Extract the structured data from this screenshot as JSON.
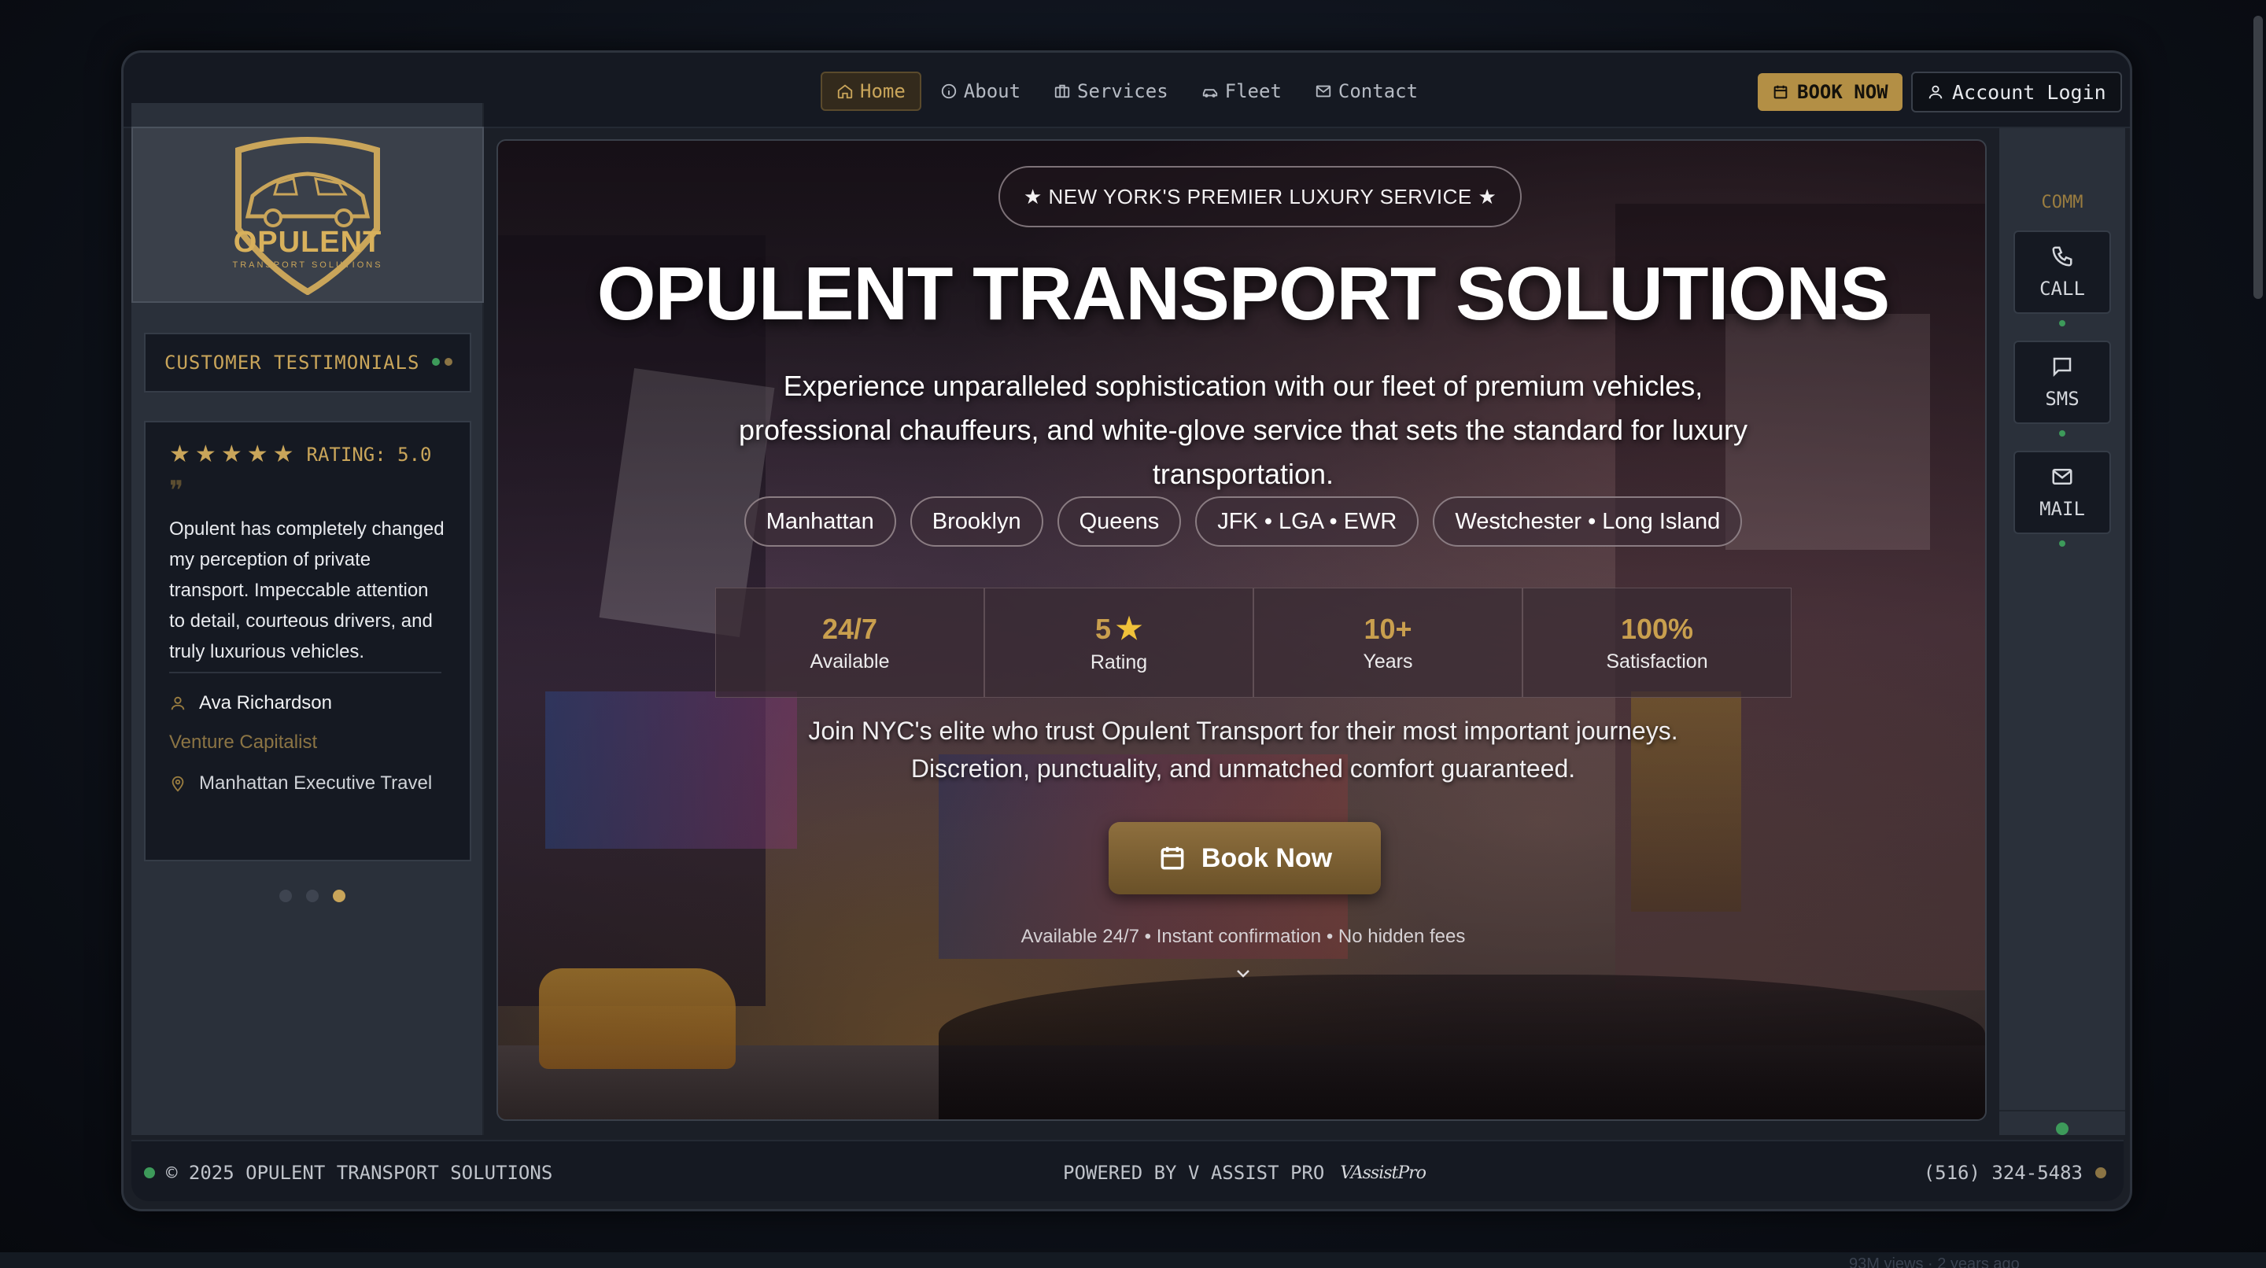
{
  "nav": {
    "links": [
      {
        "label": "Home",
        "icon": "home-icon",
        "active": true
      },
      {
        "label": "About",
        "icon": "info-icon",
        "active": false
      },
      {
        "label": "Services",
        "icon": "briefcase-icon",
        "active": false
      },
      {
        "label": "Fleet",
        "icon": "car-icon",
        "active": false
      },
      {
        "label": "Contact",
        "icon": "mail-icon",
        "active": false
      }
    ],
    "book_label": "BOOK NOW",
    "login_label": "Account Login"
  },
  "brand": {
    "logo_name": "OPULENT",
    "logo_tagline": "TRANSPORT SOLUTIONS",
    "gold": "#c9a55a"
  },
  "testimonials": {
    "header": "CUSTOMER TESTIMONIALS",
    "rating_label": "RATING: 5.0",
    "stars": 5,
    "quote": "Opulent has completely changed my perception of private transport. Impeccable attention to detail, courteous drivers, and truly luxurious vehicles.",
    "author": "Ava Richardson",
    "role": "Venture Capitalist",
    "location": "Manhattan Executive Travel",
    "page_count": 3,
    "active_page": 3
  },
  "hero": {
    "badge": "★ NEW YORK'S PREMIER LUXURY SERVICE ★",
    "title": "OPULENT TRANSPORT SOLUTIONS",
    "description": "Experience unparalleled sophistication with our fleet of premium vehicles, professional chauffeurs, and white-glove service that sets the standard for luxury transportation.",
    "tags": [
      "Manhattan",
      "Brooklyn",
      "Queens",
      "JFK • LGA • EWR",
      "Westchester • Long Island"
    ],
    "stats": [
      {
        "value": "24/7",
        "label": "Available"
      },
      {
        "value": "5",
        "label": "Rating",
        "star": true
      },
      {
        "value": "10+",
        "label": "Years"
      },
      {
        "value": "100%",
        "label": "Satisfaction"
      }
    ],
    "join_text_1": "Join NYC's elite who trust Opulent Transport for their most important journeys.",
    "join_text_2": "Discretion, punctuality, and unmatched comfort guaranteed.",
    "cta_label": "Book Now",
    "note": "Available 24/7 • Instant confirmation • No hidden fees"
  },
  "comm": {
    "label": "COMM",
    "buttons": [
      {
        "label": "CALL",
        "icon": "phone-icon"
      },
      {
        "label": "SMS",
        "icon": "message-icon"
      },
      {
        "label": "MAIL",
        "icon": "mail-icon"
      }
    ],
    "status_colors": [
      "#3d9a5a",
      "#8b7444",
      "#4f6aa5"
    ]
  },
  "footer": {
    "copyright": "© 2025 OPULENT TRANSPORT SOLUTIONS",
    "powered": "POWERED BY V ASSIST PRO",
    "powered_logo": "VAssistPro",
    "phone": "(516) 324-5483"
  },
  "background": {
    "tail_text": "93M views · 2 years ago"
  }
}
